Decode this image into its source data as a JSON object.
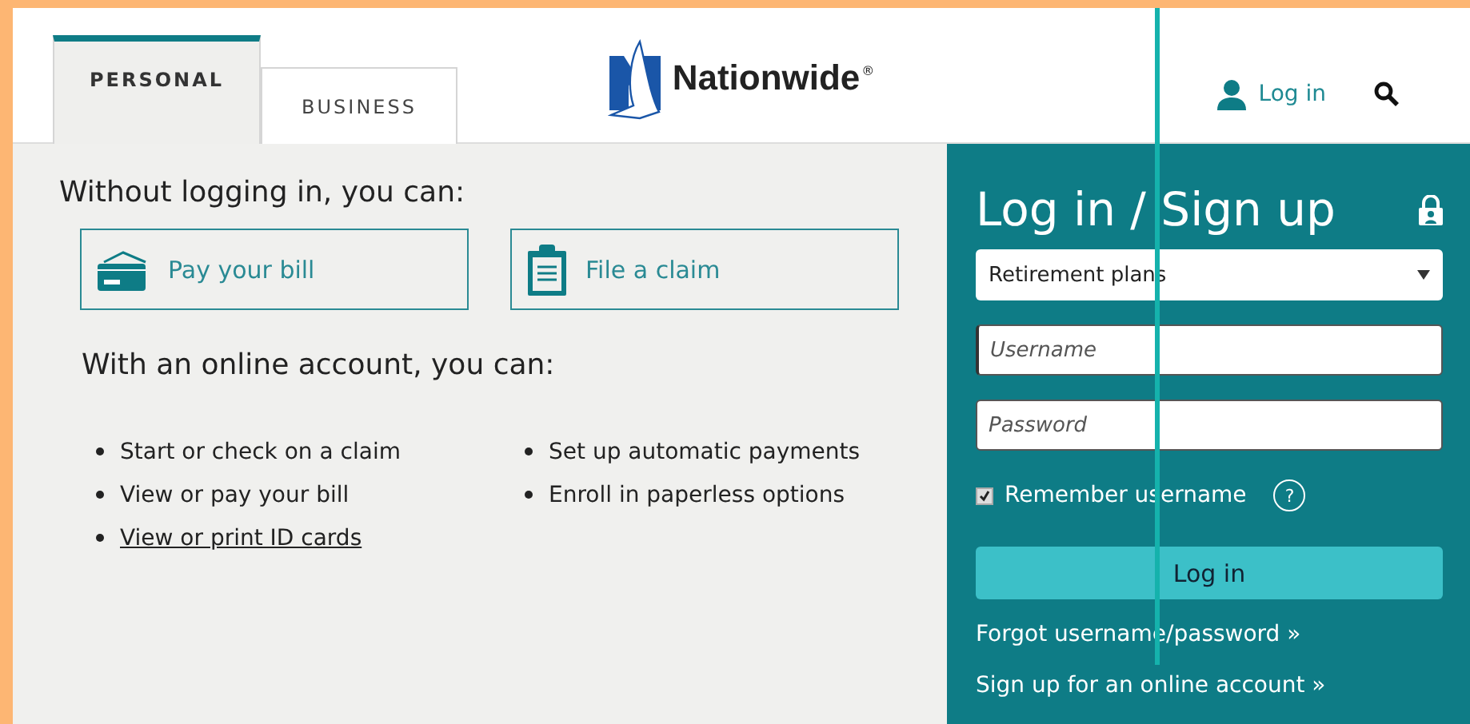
{
  "header": {
    "tabs": [
      {
        "label": "PERSONAL",
        "selected": true
      },
      {
        "label": "BUSINESS",
        "selected": false
      }
    ],
    "logo": {
      "wordmark": "Nationwide",
      "mark": "®"
    },
    "login_link": "Log in"
  },
  "offline": {
    "heading": "Without logging in, you can:",
    "actions": [
      {
        "label": "Pay your bill",
        "kind": "bill"
      },
      {
        "label": "File a claim",
        "kind": "claim"
      }
    ]
  },
  "online": {
    "heading": "With an online account, you can:",
    "columns": [
      [
        {
          "text": "Start or check on a claim",
          "link": false
        },
        {
          "text": "View or pay your bill",
          "link": false
        },
        {
          "text": "View or print ID cards",
          "link": true
        }
      ],
      [
        {
          "text": "Set up automatic payments",
          "link": false
        },
        {
          "text": "Enroll in paperless options",
          "link": false
        }
      ]
    ]
  },
  "login": {
    "title": "Log in / Sign up",
    "plan": "Retirement plans",
    "username": {
      "placeholder": "Username",
      "focused": true
    },
    "password": {
      "placeholder": "Password"
    },
    "remember": {
      "label": "Remember username",
      "checked": true
    },
    "help": "?",
    "button": "Log in",
    "links": [
      "Forgot username/password »",
      "Sign up for an online account »"
    ]
  }
}
